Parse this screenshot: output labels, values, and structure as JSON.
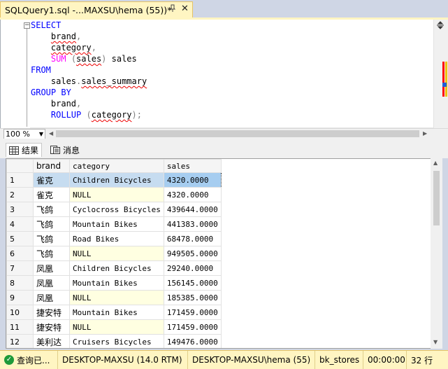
{
  "tab": {
    "title": "SQLQuery1.sql -...MAXSU\\hema (55))*",
    "pin_icon": "pin-icon",
    "close_icon": "close-icon"
  },
  "editor": {
    "lines": [
      {
        "segments": [
          {
            "t": "SELECT",
            "k": "kw"
          }
        ]
      },
      {
        "segments": [
          {
            "t": "    "
          },
          {
            "t": "brand",
            "k": "id squig"
          },
          {
            "t": ",",
            "k": "op"
          }
        ]
      },
      {
        "segments": [
          {
            "t": "    "
          },
          {
            "t": "category",
            "k": "id squig"
          },
          {
            "t": ",",
            "k": "op"
          }
        ]
      },
      {
        "segments": [
          {
            "t": "    "
          },
          {
            "t": "SUM",
            "k": "fn"
          },
          {
            "t": " (",
            "k": "op"
          },
          {
            "t": "sales",
            "k": "id squig"
          },
          {
            "t": ")",
            "k": "op"
          },
          {
            "t": " sales",
            "k": "id"
          }
        ]
      },
      {
        "segments": [
          {
            "t": "FROM",
            "k": "kw"
          }
        ]
      },
      {
        "segments": [
          {
            "t": "    "
          },
          {
            "t": "sales",
            "k": "id"
          },
          {
            "t": ".",
            "k": "op"
          },
          {
            "t": "sales_summary",
            "k": "id squig"
          }
        ]
      },
      {
        "segments": [
          {
            "t": "GROUP BY",
            "k": "kw"
          }
        ]
      },
      {
        "segments": [
          {
            "t": "    "
          },
          {
            "t": "brand",
            "k": "id"
          },
          {
            "t": ",",
            "k": "op"
          }
        ]
      },
      {
        "segments": [
          {
            "t": "    "
          },
          {
            "t": "ROLLUP",
            "k": "kw"
          },
          {
            "t": " (",
            "k": "op"
          },
          {
            "t": "category",
            "k": "id squig"
          },
          {
            "t": ");",
            "k": "op"
          }
        ]
      }
    ],
    "zoom": "100 %"
  },
  "results_tabs": [
    {
      "label": "结果",
      "icon": "grid-icon"
    },
    {
      "label": "消息",
      "icon": "messages-icon"
    }
  ],
  "grid": {
    "columns": [
      "brand",
      "category",
      "sales"
    ],
    "rows": [
      {
        "n": "1",
        "brand": "雀克",
        "category": "Children Bicycles",
        "sales": "4320.0000"
      },
      {
        "n": "2",
        "brand": "雀克",
        "category": "NULL",
        "sales": "4320.0000"
      },
      {
        "n": "3",
        "brand": "飞鸽",
        "category": "Cyclocross Bicycles",
        "sales": "439644.0000"
      },
      {
        "n": "4",
        "brand": "飞鸽",
        "category": "Mountain Bikes",
        "sales": "441383.0000"
      },
      {
        "n": "5",
        "brand": "飞鸽",
        "category": "Road Bikes",
        "sales": "68478.0000"
      },
      {
        "n": "6",
        "brand": "飞鸽",
        "category": "NULL",
        "sales": "949505.0000"
      },
      {
        "n": "7",
        "brand": "凤凰",
        "category": "Children Bicycles",
        "sales": "29240.0000"
      },
      {
        "n": "8",
        "brand": "凤凰",
        "category": "Mountain Bikes",
        "sales": "156145.0000"
      },
      {
        "n": "9",
        "brand": "凤凰",
        "category": "NULL",
        "sales": "185385.0000"
      },
      {
        "n": "10",
        "brand": "捷安特",
        "category": "Mountain Bikes",
        "sales": "171459.0000"
      },
      {
        "n": "11",
        "brand": "捷安特",
        "category": "NULL",
        "sales": "171459.0000"
      },
      {
        "n": "12",
        "brand": "美利达",
        "category": "Cruisers Bicycles",
        "sales": "149476.0000"
      }
    ]
  },
  "status": {
    "state": "查询已...",
    "server": "DESKTOP-MAXSU (14.0 RTM)",
    "user": "DESKTOP-MAXSU\\hema (55)",
    "database": "bk_stores",
    "elapsed": "00:00:00",
    "rows": "32 行"
  }
}
